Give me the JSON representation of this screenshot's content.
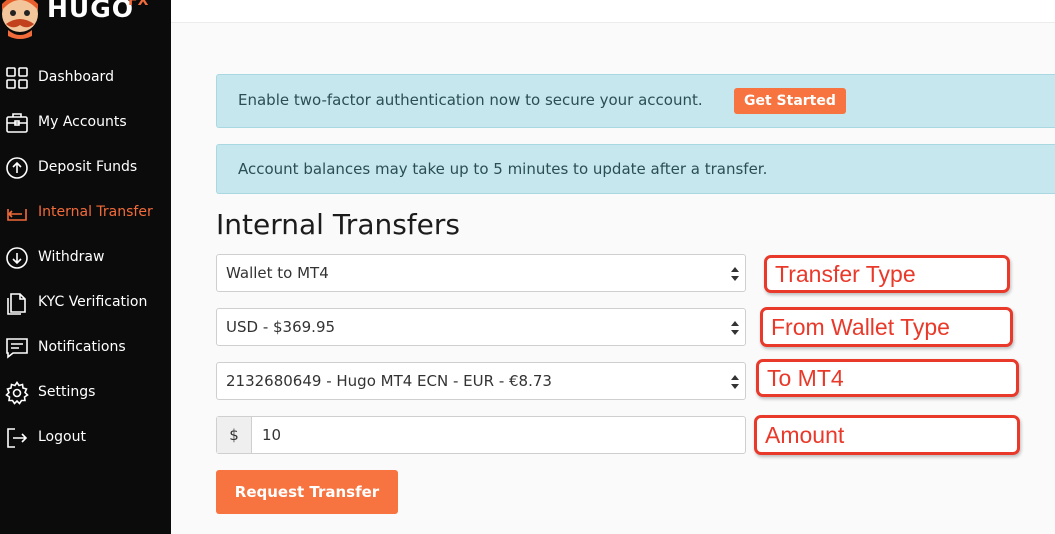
{
  "brand": {
    "name": "HUGO",
    "suffix": "FX",
    "accent": "#f26b3a"
  },
  "sidebar": {
    "items": [
      {
        "label": "Dashboard",
        "icon": "grid-icon",
        "active": false
      },
      {
        "label": "My Accounts",
        "icon": "briefcase-icon",
        "active": false
      },
      {
        "label": "Deposit Funds",
        "icon": "arrow-up-circle-icon",
        "active": false
      },
      {
        "label": "Internal Transfer",
        "icon": "transfer-icon",
        "active": true
      },
      {
        "label": "Withdraw",
        "icon": "arrow-down-circle-icon",
        "active": false
      },
      {
        "label": "KYC Verification",
        "icon": "document-icon",
        "active": false
      },
      {
        "label": "Notifications",
        "icon": "chat-icon",
        "active": false
      },
      {
        "label": "Settings",
        "icon": "gear-icon",
        "active": false
      },
      {
        "label": "Logout",
        "icon": "logout-icon",
        "active": false
      }
    ]
  },
  "alerts": {
    "two_factor": {
      "text": "Enable two-factor authentication now to secure your account.",
      "button": "Get Started"
    },
    "balance": {
      "text": "Account balances may take up to 5 minutes to update after a transfer."
    }
  },
  "page": {
    "title": "Internal Transfers"
  },
  "form": {
    "transfer_type": "Wallet to MT4",
    "from_wallet": "USD - $369.95",
    "to_mt4": "2132680649 - Hugo MT4 ECN - EUR - €8.73",
    "amount_prefix": "$",
    "amount_value": "10",
    "submit": "Request Transfer"
  },
  "annotations": {
    "transfer_type": "Transfer Type",
    "from_wallet": "From Wallet Type",
    "to_mt4": "To MT4",
    "amount": "Amount"
  },
  "colors": {
    "sidebar_bg": "#0b0b0b",
    "button": "#f7733f",
    "alert_bg": "#c6e7ed",
    "annotation": "#e8392a"
  }
}
